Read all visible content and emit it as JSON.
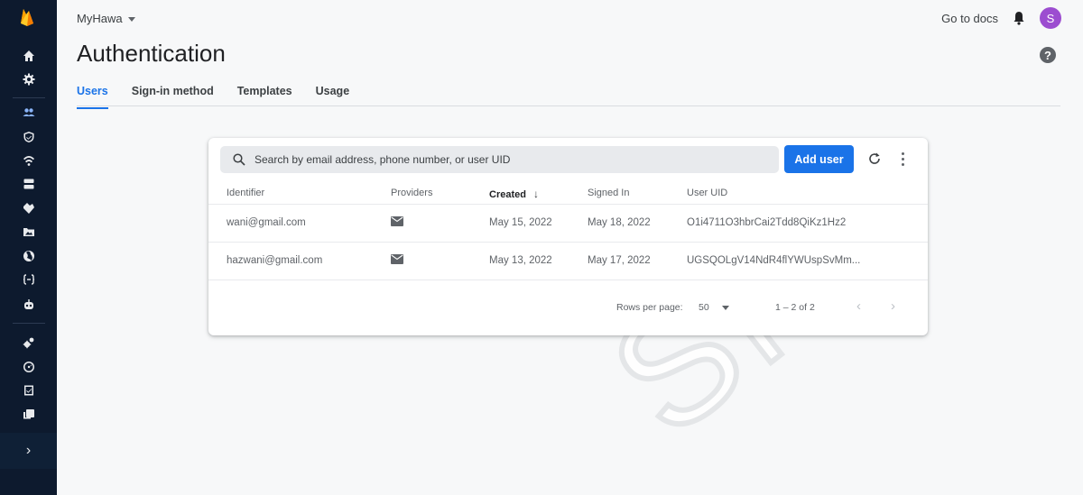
{
  "project": {
    "name": "MyHawa"
  },
  "header": {
    "docs_link": "Go to docs",
    "avatar_initial": "S"
  },
  "page": {
    "title": "Authentication"
  },
  "tabs": [
    {
      "label": "Users",
      "active": true
    },
    {
      "label": "Sign-in method",
      "active": false
    },
    {
      "label": "Templates",
      "active": false
    },
    {
      "label": "Usage",
      "active": false
    }
  ],
  "search": {
    "placeholder": "Search by email address, phone number, or user UID"
  },
  "toolbar": {
    "add_user_label": "Add user"
  },
  "table": {
    "columns": [
      "Identifier",
      "Providers",
      "Created",
      "Signed In",
      "User UID"
    ],
    "rows": [
      {
        "identifier": "wani@gmail.com",
        "provider": "email-icon",
        "created": "May 15, 2022",
        "signed_in": "May 18, 2022",
        "uid": "O1i4711O3hbrCai2Tdd8QiKz1Hz2"
      },
      {
        "identifier": "hazwani@gmail.com",
        "provider": "email-icon",
        "created": "May 13, 2022",
        "signed_in": "May 17, 2022",
        "uid": "UGSQOLgV14NdR4flYWUspSvMm..."
      }
    ]
  },
  "pagination": {
    "rows_per_page_label": "Rows per page:",
    "rows_per_page_value": "50",
    "range": "1 – 2 of 2"
  },
  "watermark": {
    "text": "SM"
  },
  "colors": {
    "rail": "#0d1a2e",
    "accent": "#1a73e8",
    "avatar": "#9c4dd0"
  }
}
